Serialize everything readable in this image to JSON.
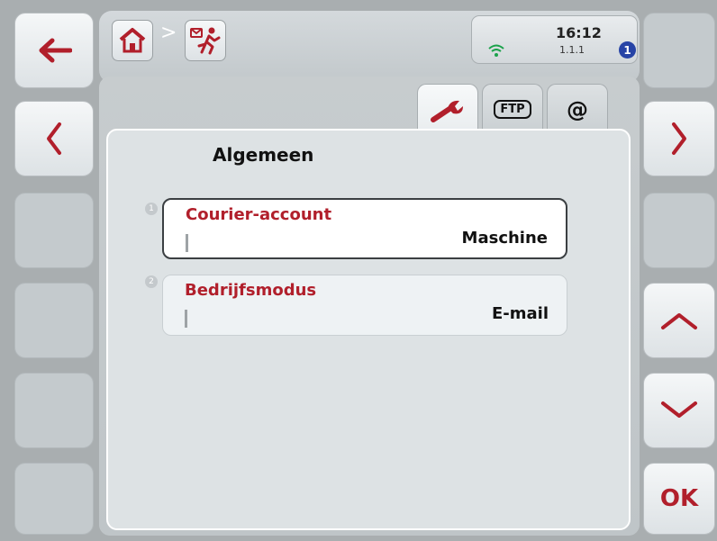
{
  "header": {
    "breadcrumb_separator": ">",
    "icons": [
      "home-icon",
      "courier-runner-icon"
    ]
  },
  "status": {
    "time": "16:12",
    "version": "1.1.1",
    "badge": "1",
    "wifi_icon": "wifi-icon"
  },
  "tabs": [
    {
      "name": "wrench-icon",
      "label": "",
      "selected": true
    },
    {
      "name": "ftp",
      "label": "FTP",
      "selected": false
    },
    {
      "name": "at",
      "label": "@",
      "selected": false
    }
  ],
  "panel": {
    "title": "Algemeen",
    "rows": [
      {
        "number": "1",
        "label": "Courier-account",
        "value": "Maschine",
        "selected": true
      },
      {
        "number": "2",
        "label": "Bedrijfsmodus",
        "value": "E-mail",
        "selected": false
      }
    ]
  },
  "softkeys": {
    "left": [
      "back-arrow-icon",
      "chevron-left-icon",
      "",
      "",
      "",
      ""
    ],
    "right": [
      "",
      "chevron-right-icon",
      "",
      "chevron-up-icon",
      "chevron-down-icon",
      "OK"
    ],
    "ok_label": "OK"
  },
  "colors": {
    "accent_red": "#b11f2b",
    "badge_blue": "#2744a6",
    "wifi_green": "#1aa24a"
  }
}
